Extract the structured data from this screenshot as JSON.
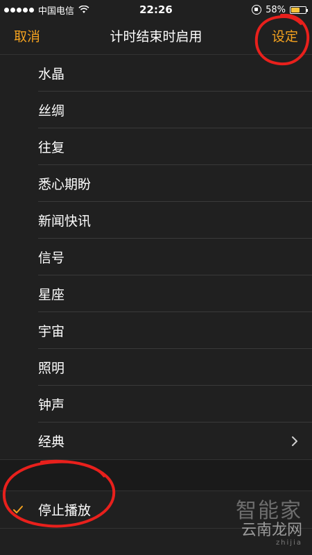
{
  "status_bar": {
    "carrier": "中国电信",
    "time": "22:26",
    "battery_text": "58%",
    "battery_level": 0.58,
    "signal_icon": "signal-dots-icon",
    "wifi_icon": "wifi-icon"
  },
  "nav": {
    "cancel_label": "取消",
    "title": "计时结束时启用",
    "set_label": "设定"
  },
  "sounds": [
    {
      "label": "水晶"
    },
    {
      "label": "丝绸"
    },
    {
      "label": "往复"
    },
    {
      "label": "悉心期盼"
    },
    {
      "label": "新闻快讯"
    },
    {
      "label": "信号"
    },
    {
      "label": "星座"
    },
    {
      "label": "宇宙"
    },
    {
      "label": "照明"
    },
    {
      "label": "钟声"
    },
    {
      "label": "经典"
    }
  ],
  "stop_playing": {
    "label": "停止播放",
    "selected": true
  },
  "watermark": {
    "line1": "智能家",
    "line2": "云南龙网",
    "line3": "zhijia"
  },
  "colors": {
    "accent": "#f4a21f",
    "background": "#202020",
    "annotation": "#e8201c"
  }
}
